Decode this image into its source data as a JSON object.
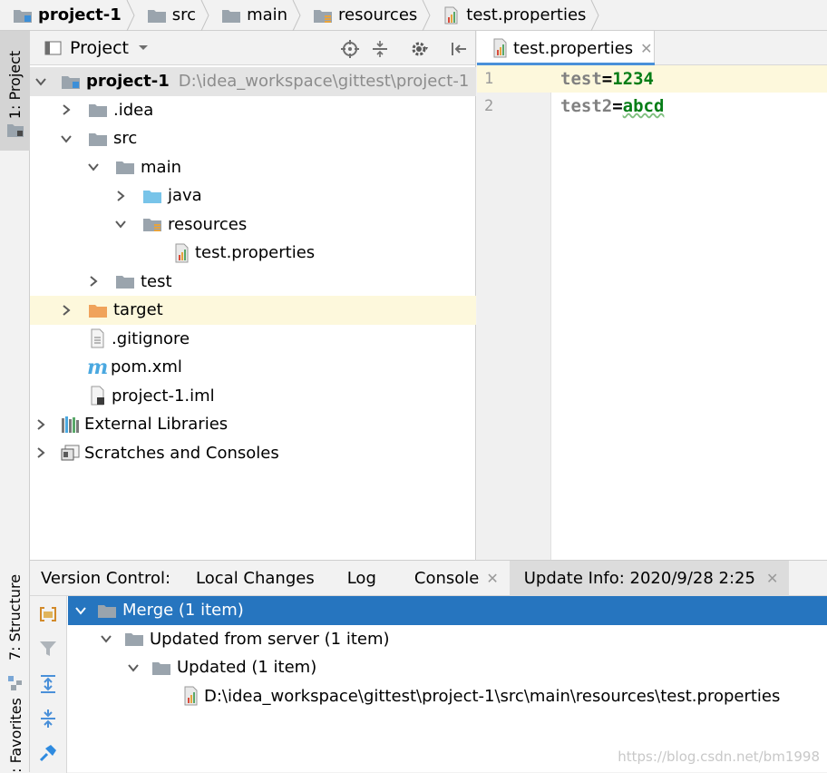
{
  "breadcrumb": [
    "project-1",
    "src",
    "main",
    "resources",
    "test.properties"
  ],
  "left_strip": {
    "project_tab": "1: Project",
    "structure_tab": "7: Structure",
    "favorites_tab": ": Favorites"
  },
  "project_panel": {
    "title": "Project",
    "tree": [
      {
        "label": "project-1",
        "path": "D:\\idea_workspace\\gittest\\project-1"
      },
      {
        "label": ".idea"
      },
      {
        "label": "src"
      },
      {
        "label": "main"
      },
      {
        "label": "java"
      },
      {
        "label": "resources"
      },
      {
        "label": "test.properties"
      },
      {
        "label": "test"
      },
      {
        "label": "target"
      },
      {
        "label": ".gitignore"
      },
      {
        "label": "pom.xml"
      },
      {
        "label": "project-1.iml"
      },
      {
        "label": "External Libraries"
      },
      {
        "label": "Scratches and Consoles"
      }
    ]
  },
  "editor": {
    "tab_label": "test.properties",
    "lines": [
      {
        "num": "1",
        "key": "test",
        "eq": "=",
        "value": "1234"
      },
      {
        "num": "2",
        "key": "test2",
        "eq": "=",
        "value": "abcd"
      }
    ]
  },
  "bottom": {
    "tabs": {
      "vc": "Version Control:",
      "local": "Local Changes",
      "log": "Log",
      "console": "Console",
      "update": "Update Info: 2020/9/28 2:25"
    },
    "tree": [
      {
        "label": "Merge (1 item)"
      },
      {
        "label": "Updated from server (1 item)"
      },
      {
        "label": "Updated (1 item)"
      },
      {
        "label": "D:\\idea_workspace\\gittest\\project-1\\src\\main\\resources\\test.properties"
      }
    ],
    "watermark": "https://blog.csdn.net/bm1998"
  },
  "colors": {
    "selection": "#2675bf",
    "highlight_row": "#fdf8dc",
    "key": "#808080",
    "value": "#067d17",
    "folder": "#9aa4ad",
    "folder_blue": "#78c4e9",
    "folder_orange": "#f0a35b"
  }
}
